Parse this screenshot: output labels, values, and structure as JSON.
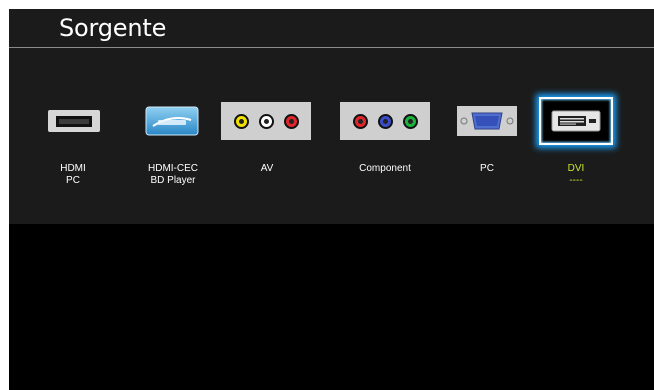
{
  "header": {
    "title": "Sorgente"
  },
  "sources": [
    {
      "id": "hdmi-pc",
      "line1": "HDMI",
      "line2": "PC",
      "icon": "hdmi-port-icon",
      "selected": false
    },
    {
      "id": "hdmi-cec",
      "line1": "HDMI-CEC",
      "line2": "BD Player",
      "icon": "anynet-icon",
      "selected": false
    },
    {
      "id": "av",
      "line1": "AV",
      "line2": "",
      "icon": "composite-rca-icon",
      "selected": false
    },
    {
      "id": "component",
      "line1": "Component",
      "line2": "",
      "icon": "component-rca-icon",
      "selected": false
    },
    {
      "id": "pc",
      "line1": "PC",
      "line2": "",
      "icon": "vga-port-icon",
      "selected": false
    },
    {
      "id": "dvi",
      "line1": "DVI",
      "line2": "----",
      "icon": "dvi-port-icon",
      "selected": true
    }
  ],
  "colors": {
    "panel": "#1b1b1b",
    "selected_label": "#c8e62e",
    "focus_glow": "#1aa3ff"
  }
}
